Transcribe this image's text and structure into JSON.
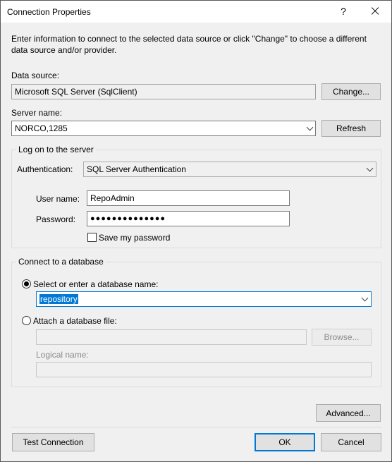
{
  "window": {
    "title": "Connection Properties",
    "help_glyph": "?"
  },
  "intro_text": "Enter information to connect to the selected data source or click \"Change\" to choose a different data source and/or provider.",
  "data_source": {
    "label": "Data source:",
    "value": "Microsoft SQL Server (SqlClient)",
    "change_button": "Change..."
  },
  "server": {
    "label": "Server name:",
    "value": "NORCO,1285",
    "refresh_button": "Refresh"
  },
  "logon": {
    "group_title": "Log on to the server",
    "auth_label": "Authentication:",
    "auth_value": "SQL Server Authentication",
    "username_label": "User name:",
    "username_value": "RepoAdmin",
    "password_label": "Password:",
    "password_mask": "●●●●●●●●●●●●●●",
    "save_password_label": "Save my password",
    "save_password_checked": false
  },
  "database": {
    "group_title": "Connect to a database",
    "select_option_label": "Select or enter a database name:",
    "select_option_checked": true,
    "database_name": "repository",
    "attach_option_label": "Attach a database file:",
    "attach_option_checked": false,
    "file_value": "",
    "browse_button": "Browse...",
    "logical_name_label": "Logical name:",
    "logical_name_value": ""
  },
  "buttons": {
    "advanced": "Advanced...",
    "test_connection": "Test Connection",
    "ok": "OK",
    "cancel": "Cancel"
  },
  "colors": {
    "accent": "#0078d7",
    "dialog_bg": "#f0f0f0"
  }
}
